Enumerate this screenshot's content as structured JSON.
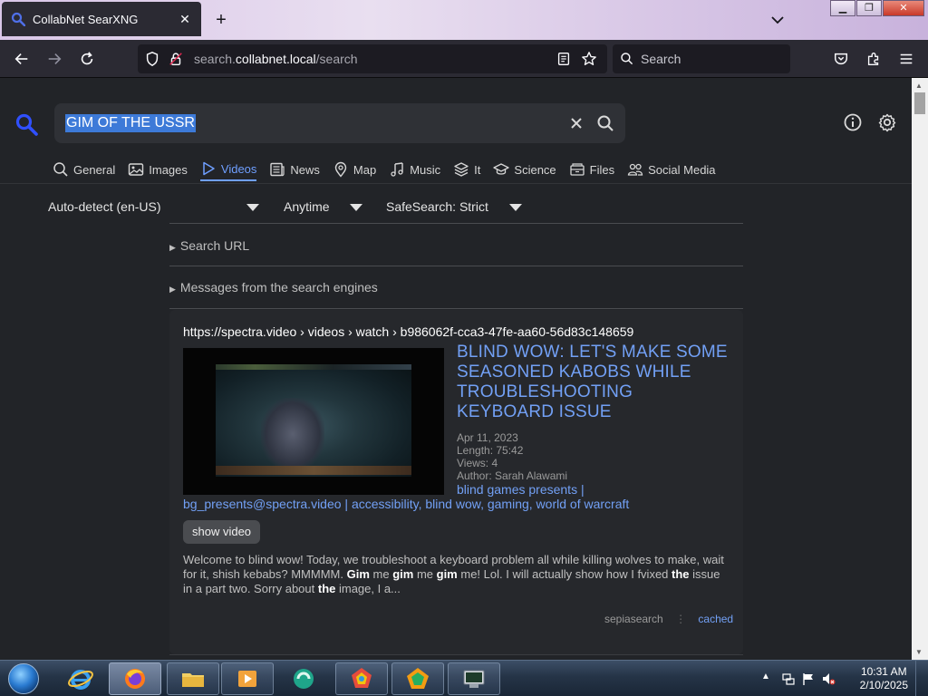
{
  "browser": {
    "tab_title": "CollabNet SearXNG",
    "url_prefix": "search.",
    "url_host": "collabnet.local",
    "url_path": "/search",
    "search_placeholder": "Search"
  },
  "search": {
    "query": "GIM OF THE USSR"
  },
  "categories": [
    {
      "label": "General",
      "icon": "search-icon"
    },
    {
      "label": "Images",
      "icon": "image-icon"
    },
    {
      "label": "Videos",
      "icon": "play-icon",
      "active": true
    },
    {
      "label": "News",
      "icon": "newspaper-icon"
    },
    {
      "label": "Map",
      "icon": "map-pin-icon"
    },
    {
      "label": "Music",
      "icon": "music-note-icon"
    },
    {
      "label": "It",
      "icon": "layers-icon"
    },
    {
      "label": "Science",
      "icon": "school-icon"
    },
    {
      "label": "Files",
      "icon": "file-drawer-icon"
    },
    {
      "label": "Social Media",
      "icon": "people-icon"
    }
  ],
  "filters": {
    "language": "Auto-detect (en-US)",
    "time": "Anytime",
    "safesearch": "SafeSearch: Strict"
  },
  "sections": {
    "search_url": "Search URL",
    "messages": "Messages from the search engines"
  },
  "result": {
    "url": "https://spectra.video  › videos › watch › b986062f-cca3-47fe-aa60-56d83c148659",
    "title": "BLIND WOW: LET'S MAKE SOME SEASONED KABOBS WHILE TROUBLESHOOTING KEYBOARD ISSUE",
    "date": "Apr 11, 2023",
    "length": "Length: 75:42",
    "views": "Views: 4",
    "author": "Author: Sarah Alawami",
    "tags_line1": "blind games presents |",
    "tags_line2": "bg_presents@spectra.video | accessibility, blind wow, gaming, world of warcraft",
    "show_video": "show video",
    "snippet_parts": [
      {
        "text": "Welcome to blind wow! Today, we troubleshoot a keyboard problem all while killing wolves to make, wait for it, shish kebabs? MMMMM. ",
        "bold": false
      },
      {
        "text": "Gim",
        "bold": true
      },
      {
        "text": " me ",
        "bold": false
      },
      {
        "text": "gim",
        "bold": true
      },
      {
        "text": " me ",
        "bold": false
      },
      {
        "text": "gim",
        "bold": true
      },
      {
        "text": " me! Lol. I will actually show how I fvixed ",
        "bold": false
      },
      {
        "text": "the",
        "bold": true
      },
      {
        "text": " issue in a part two. Sorry about ",
        "bold": false
      },
      {
        "text": "the",
        "bold": true
      },
      {
        "text": " image, I a...",
        "bold": false
      }
    ],
    "engine": "sepiasearch",
    "cached": "cached"
  },
  "taskbar": {
    "time": "10:31 AM",
    "date": "2/10/2025"
  },
  "colors": {
    "accent": "#6f9fff",
    "link": "#72a0f5",
    "page_bg": "#222428",
    "browser_chrome": "#2b2a33"
  }
}
